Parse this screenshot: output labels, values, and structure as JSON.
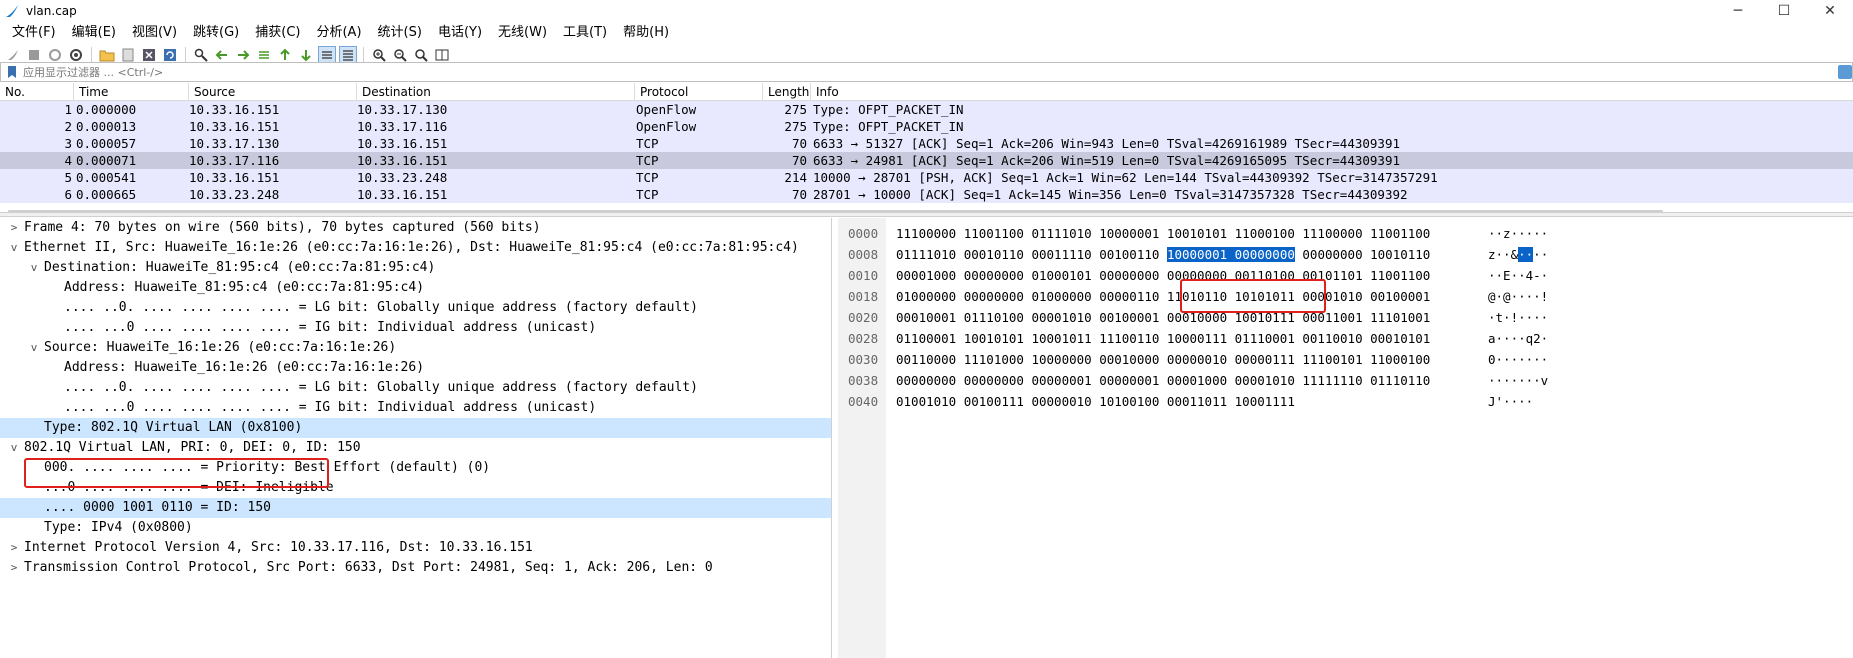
{
  "window": {
    "title": "vlan.cap",
    "minimize": "─",
    "maximize": "☐",
    "close": "✕"
  },
  "menu": [
    "文件(F)",
    "编辑(E)",
    "视图(V)",
    "跳转(G)",
    "捕获(C)",
    "分析(A)",
    "统计(S)",
    "电话(Y)",
    "无线(W)",
    "工具(T)",
    "帮助(H)"
  ],
  "filter": {
    "placeholder": "应用显示过滤器 ... <Ctrl-/>"
  },
  "packet_list": {
    "columns": [
      "No.",
      "Time",
      "Source",
      "Destination",
      "Protocol",
      "Length",
      "Info"
    ],
    "rows": [
      {
        "no": "1",
        "time": "0.000000",
        "src": "10.33.16.151",
        "dst": "10.33.17.130",
        "proto": "OpenFlow",
        "len": "275",
        "info": "Type: OFPT_PACKET_IN"
      },
      {
        "no": "2",
        "time": "0.000013",
        "src": "10.33.16.151",
        "dst": "10.33.17.116",
        "proto": "OpenFlow",
        "len": "275",
        "info": "Type: OFPT_PACKET_IN"
      },
      {
        "no": "3",
        "time": "0.000057",
        "src": "10.33.17.130",
        "dst": "10.33.16.151",
        "proto": "TCP",
        "len": "70",
        "info": "6633 → 51327 [ACK] Seq=1 Ack=206 Win=943 Len=0 TSval=4269161989 TSecr=44309391"
      },
      {
        "no": "4",
        "time": "0.000071",
        "src": "10.33.17.116",
        "dst": "10.33.16.151",
        "proto": "TCP",
        "len": "70",
        "info": "6633 → 24981 [ACK] Seq=1 Ack=206 Win=519 Len=0 TSval=4269165095 TSecr=44309391"
      },
      {
        "no": "5",
        "time": "0.000541",
        "src": "10.33.16.151",
        "dst": "10.33.23.248",
        "proto": "TCP",
        "len": "214",
        "info": "10000 → 28701 [PSH, ACK] Seq=1 Ack=1 Win=62 Len=144 TSval=44309392 TSecr=3147357291"
      },
      {
        "no": "6",
        "time": "0.000665",
        "src": "10.33.23.248",
        "dst": "10.33.16.151",
        "proto": "TCP",
        "len": "70",
        "info": "28701 → 10000 [ACK] Seq=1 Ack=145 Win=356 Len=0 TSval=3147357328 TSecr=44309392"
      }
    ]
  },
  "details": [
    {
      "arrow": ">",
      "text": "Frame 4: 70 bytes on wire (560 bits), 70 bytes captured (560 bits)",
      "level": 0
    },
    {
      "arrow": "v",
      "text": "Ethernet II, Src: HuaweiTe_16:1e:26 (e0:cc:7a:16:1e:26), Dst: HuaweiTe_81:95:c4 (e0:cc:7a:81:95:c4)",
      "level": 0
    },
    {
      "arrow": "v",
      "text": "Destination: HuaweiTe_81:95:c4 (e0:cc:7a:81:95:c4)",
      "level": 1
    },
    {
      "arrow": "",
      "text": "Address: HuaweiTe_81:95:c4 (e0:cc:7a:81:95:c4)",
      "level": 2
    },
    {
      "arrow": "",
      "text": ".... ..0. .... .... .... .... = LG bit: Globally unique address (factory default)",
      "level": 2
    },
    {
      "arrow": "",
      "text": ".... ...0 .... .... .... .... = IG bit: Individual address (unicast)",
      "level": 2
    },
    {
      "arrow": "v",
      "text": "Source: HuaweiTe_16:1e:26 (e0:cc:7a:16:1e:26)",
      "level": 1
    },
    {
      "arrow": "",
      "text": "Address: HuaweiTe_16:1e:26 (e0:cc:7a:16:1e:26)",
      "level": 2
    },
    {
      "arrow": "",
      "text": ".... ..0. .... .... .... .... = LG bit: Globally unique address (factory default)",
      "level": 2
    },
    {
      "arrow": "",
      "text": ".... ...0 .... .... .... .... = IG bit: Individual address (unicast)",
      "level": 2
    },
    {
      "arrow": "",
      "text": "Type: 802.1Q Virtual LAN (0x8100)",
      "level": 1,
      "highlight": true
    },
    {
      "arrow": "v",
      "text": "802.1Q Virtual LAN, PRI: 0, DEI: 0, ID: 150",
      "level": 0
    },
    {
      "arrow": "",
      "text": "000. .... .... .... = Priority: Best Effort (default) (0)",
      "level": 1
    },
    {
      "arrow": "",
      "text": "...0 .... .... .... = DEI: Ineligible",
      "level": 1
    },
    {
      "arrow": "",
      "text": ".... 0000 1001 0110 = ID: 150",
      "level": 1,
      "highlight": true
    },
    {
      "arrow": "",
      "text": "Type: IPv4 (0x0800)",
      "level": 1
    },
    {
      "arrow": ">",
      "text": "Internet Protocol Version 4, Src: 10.33.17.116, Dst: 10.33.16.151",
      "level": 0
    },
    {
      "arrow": ">",
      "text": "Transmission Control Protocol, Src Port: 6633, Dst Port: 24981, Seq: 1, Ack: 206, Len: 0",
      "level": 0
    }
  ],
  "bytes": [
    {
      "off": "0000",
      "pre": "11100000 11001100 01111010 10000001 10010101 11000100 11100000 11001100",
      "sel": "",
      "post": "",
      "ascii_pre": "··z·····",
      "ascii_sel": "",
      "ascii_post": ""
    },
    {
      "off": "0008",
      "pre": "01111010 00010110 00011110 00100110 ",
      "sel": "10000001 00000000",
      "post": " 00000000 10010110",
      "ascii_pre": "z··&",
      "ascii_sel": "··",
      "ascii_post": "··"
    },
    {
      "off": "0010",
      "pre": "00001000 00000000 01000101 00000000 00000000 00110100 00101101 11001100",
      "sel": "",
      "post": "",
      "ascii_pre": "··E··4-·",
      "ascii_sel": "",
      "ascii_post": ""
    },
    {
      "off": "0018",
      "pre": "01000000 00000000 01000000 00000110 11010110 10101011 00001010 00100001",
      "sel": "",
      "post": "",
      "ascii_pre": "@·@····!",
      "ascii_sel": "",
      "ascii_post": ""
    },
    {
      "off": "0020",
      "pre": "00010001 01110100 00001010 00100001 00010000 10010111 00011001 11101001",
      "sel": "",
      "post": "",
      "ascii_pre": "·t·!····",
      "ascii_sel": "",
      "ascii_post": ""
    },
    {
      "off": "0028",
      "pre": "01100001 10010101 10001011 11100110 10000111 01110001 00110010 00010101",
      "sel": "",
      "post": "",
      "ascii_pre": "a····q2·",
      "ascii_sel": "",
      "ascii_post": ""
    },
    {
      "off": "0030",
      "pre": "00110000 11101000 10000000 00010000 00000010 00000111 11100101 11000100",
      "sel": "",
      "post": "",
      "ascii_pre": "0·······",
      "ascii_sel": "",
      "ascii_post": ""
    },
    {
      "off": "0038",
      "pre": "00000000 00000000 00000001 00000001 00001000 00001010 11111110 01110110",
      "sel": "",
      "post": "",
      "ascii_pre": "·······v",
      "ascii_sel": "",
      "ascii_post": ""
    },
    {
      "off": "0040",
      "pre": "01001010 00100111 00000010 10100100 00011011 10001111",
      "sel": "",
      "post": "",
      "ascii_pre": "J'····",
      "ascii_sel": "",
      "ascii_post": ""
    }
  ],
  "colors": {
    "row_bg": "#e8e8ff",
    "row_selected": "#c9c9de",
    "detail_highlight": "#cce6ff",
    "byte_selected": "#0a64c8",
    "annotation_red": "#e0201b"
  }
}
